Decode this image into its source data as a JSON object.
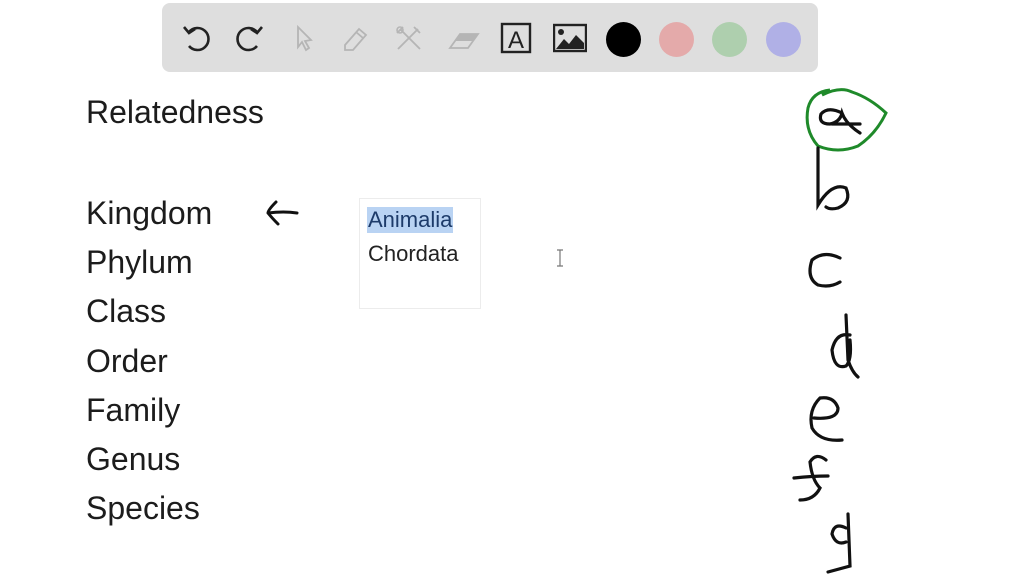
{
  "toolbar": {
    "tools": [
      {
        "name": "undo",
        "icon": "undo-icon",
        "enabled": true
      },
      {
        "name": "redo",
        "icon": "redo-icon",
        "enabled": true
      },
      {
        "name": "select",
        "icon": "pointer-icon",
        "enabled": false
      },
      {
        "name": "pen",
        "icon": "pencil-icon",
        "enabled": false
      },
      {
        "name": "tools",
        "icon": "tools-icon",
        "enabled": false
      },
      {
        "name": "eraser",
        "icon": "eraser-icon",
        "enabled": false
      },
      {
        "name": "text",
        "icon": "text-box-icon",
        "label": "A",
        "enabled": true
      },
      {
        "name": "image",
        "icon": "image-icon",
        "enabled": true
      }
    ],
    "colors": [
      {
        "name": "black",
        "hex": "#000000",
        "selected": true
      },
      {
        "name": "red",
        "hex": "#e4aaaa"
      },
      {
        "name": "green",
        "hex": "#aecfae"
      },
      {
        "name": "blue",
        "hex": "#b0b0e6"
      }
    ]
  },
  "content": {
    "heading": "Relatedness",
    "ranks": [
      "Kingdom",
      "Phylum",
      "Class",
      "Order",
      "Family",
      "Genus",
      "Species"
    ],
    "textbox": {
      "lines": [
        "Animalia",
        "Chordata"
      ],
      "selected_line": "Animalia"
    },
    "handwriting": {
      "letters": [
        "a",
        "b",
        "c",
        "d",
        "e",
        "f",
        "g"
      ],
      "circled": "a",
      "circle_color": "#1f8a2a",
      "arrow_points_to": "Kingdom"
    }
  }
}
